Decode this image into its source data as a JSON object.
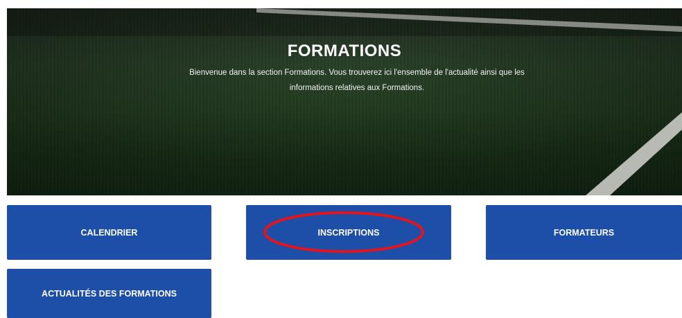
{
  "hero": {
    "title": "FORMATIONS",
    "subtitle_line1": "Bienvenue dans la section Formations. Vous trouverez ici l'ensemble de l'actualité ainsi que les",
    "subtitle_line2": "informations relatives aux Formations."
  },
  "buttons": {
    "calendrier": "CALENDRIER",
    "inscriptions": "INSCRIPTIONS",
    "formateurs": "FORMATEURS",
    "actualites": "ACTUALITÉS DES FORMATIONS"
  },
  "colors": {
    "button_bg": "#1d4fa8",
    "highlight": "#e3141b"
  }
}
